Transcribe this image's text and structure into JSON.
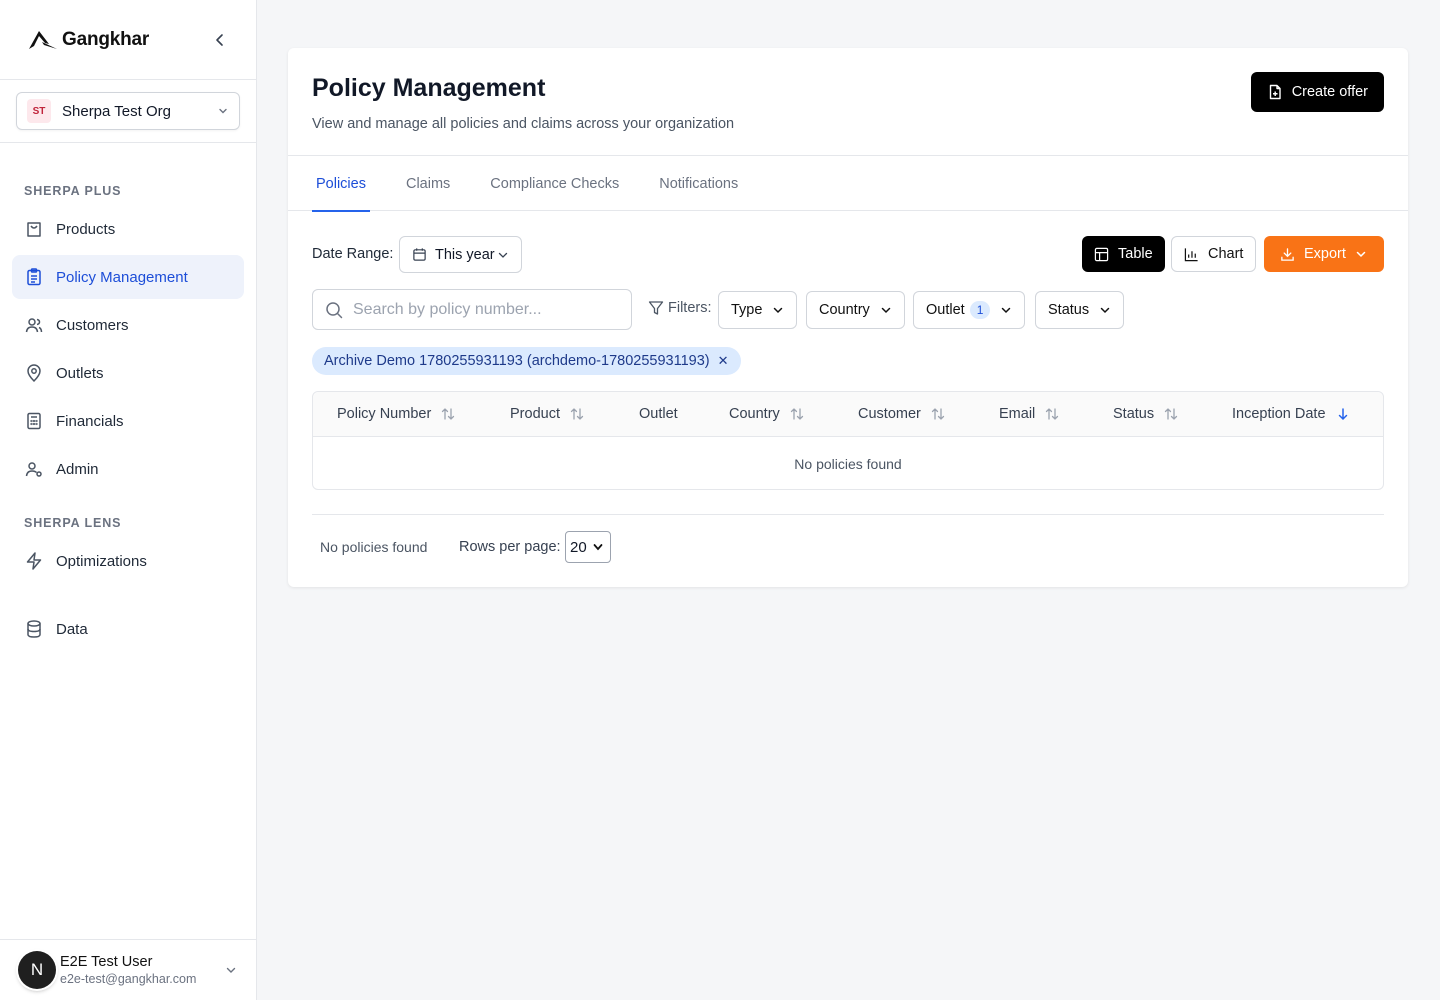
{
  "app": {
    "name": "Gangkhar"
  },
  "org": {
    "initials": "ST",
    "name": "Sherpa Test Org"
  },
  "sidebar": {
    "sections": [
      {
        "label": "SHERPA PLUS"
      },
      {
        "label": "SHERPA LENS"
      }
    ],
    "items": [
      {
        "label": "Products",
        "icon": "shopping-bag-icon"
      },
      {
        "label": "Policy Management",
        "icon": "clipboard-list-icon",
        "active": true
      },
      {
        "label": "Customers",
        "icon": "users-icon"
      },
      {
        "label": "Outlets",
        "icon": "map-pin-icon"
      },
      {
        "label": "Financials",
        "icon": "calculator-icon"
      },
      {
        "label": "Admin",
        "icon": "user-cog-icon"
      },
      {
        "label": "Optimizations",
        "icon": "zap-icon"
      },
      {
        "label": "Data",
        "icon": "database-icon"
      }
    ]
  },
  "user": {
    "avatar_letter": "N",
    "name": "E2E Test User",
    "email": "e2e-test@gangkhar.com"
  },
  "page": {
    "title": "Policy Management",
    "subtitle": "View and manage all policies and claims across your organization",
    "create_label": "Create offer"
  },
  "tabs": [
    {
      "label": "Policies",
      "active": true
    },
    {
      "label": "Claims"
    },
    {
      "label": "Compliance Checks"
    },
    {
      "label": "Notifications"
    }
  ],
  "toolbar": {
    "date_range_label": "Date Range:",
    "date_range_value": "This year",
    "table_label": "Table",
    "chart_label": "Chart",
    "export_label": "Export",
    "export_color": "#f97316"
  },
  "search": {
    "placeholder": "Search by policy number...",
    "value": ""
  },
  "filters": {
    "label": "Filters:",
    "type": "Type",
    "country": "Country",
    "outlet": "Outlet",
    "outlet_count": "1",
    "status": "Status"
  },
  "active_filter_chip": "Archive Demo 1780255931193 (archdemo-1780255931193)",
  "table": {
    "columns": [
      {
        "label": "Policy Number",
        "sort": "both"
      },
      {
        "label": "Product",
        "sort": "both"
      },
      {
        "label": "Outlet",
        "sort": "none"
      },
      {
        "label": "Country",
        "sort": "both"
      },
      {
        "label": "Customer",
        "sort": "both"
      },
      {
        "label": "Email",
        "sort": "both"
      },
      {
        "label": "Status",
        "sort": "both"
      },
      {
        "label": "Inception Date",
        "sort": "desc"
      }
    ],
    "empty_text": "No policies found"
  },
  "pagination": {
    "summary": "No policies found",
    "rows_per_page_label": "Rows per page:",
    "rows_per_page": "20"
  }
}
